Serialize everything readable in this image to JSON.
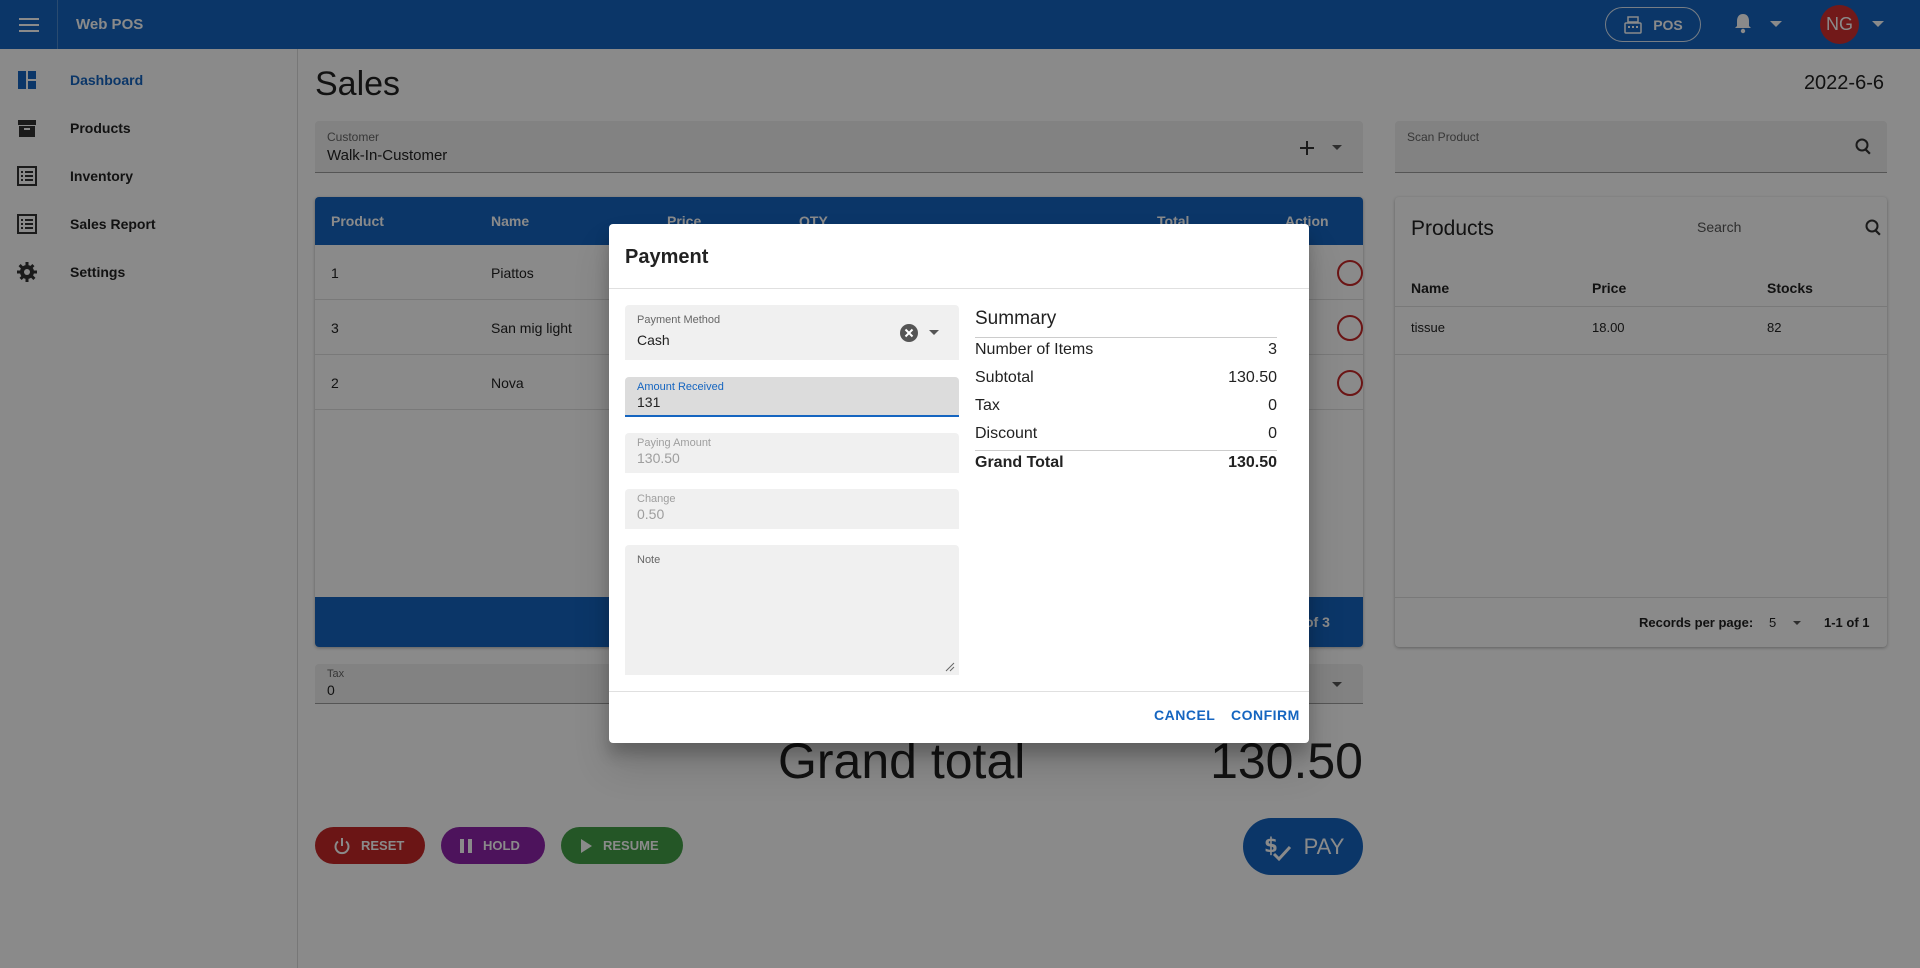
{
  "app": {
    "title": "Web POS",
    "pos_label": "POS",
    "avatar_initials": "NG"
  },
  "sidebar": {
    "items": [
      {
        "label": "Dashboard",
        "icon": "dashboard-icon"
      },
      {
        "label": "Products",
        "icon": "archive-icon"
      },
      {
        "label": "Inventory",
        "icon": "list-icon"
      },
      {
        "label": "Sales Report",
        "icon": "list-icon"
      },
      {
        "label": "Settings",
        "icon": "gear-icon"
      }
    ]
  },
  "page": {
    "title": "Sales",
    "date": "2022-6-6"
  },
  "customer": {
    "label": "Customer",
    "value": "Walk-In-Customer"
  },
  "scan": {
    "label": "Scan Product"
  },
  "sales_table": {
    "columns": [
      "Product",
      "Name",
      "Price",
      "QTY",
      "Total",
      "Action"
    ],
    "rows": [
      {
        "product": "1",
        "name": "Piattos"
      },
      {
        "product": "3",
        "name": "San mig light"
      },
      {
        "product": "2",
        "name": "Nova"
      }
    ],
    "footer": "of 3"
  },
  "tax_field": {
    "label": "Tax",
    "value": "0"
  },
  "grand_total": {
    "label": "Grand total",
    "value": "130.50"
  },
  "actions": {
    "reset": "RESET",
    "hold": "HOLD",
    "resume": "RESUME",
    "pay": "PAY"
  },
  "products_panel": {
    "title": "Products",
    "search_placeholder": "Search",
    "columns": [
      "Name",
      "Price",
      "Stocks"
    ],
    "rows": [
      {
        "name": "tissue",
        "price": "18.00",
        "stocks": "82"
      }
    ],
    "records_label": "Records per page:",
    "records_value": "5",
    "range": "1-1 of 1"
  },
  "payment_dialog": {
    "title": "Payment",
    "payment_method": {
      "label": "Payment Method",
      "value": "Cash"
    },
    "amount_received": {
      "label": "Amount Received",
      "value": "131"
    },
    "paying_amount": {
      "label": "Paying Amount",
      "value": "130.50"
    },
    "change": {
      "label": "Change",
      "value": "0.50"
    },
    "note": {
      "label": "Note",
      "value": ""
    },
    "summary": {
      "title": "Summary",
      "rows": [
        {
          "label": "Number of Items",
          "value": "3"
        },
        {
          "label": "Subtotal",
          "value": "130.50"
        },
        {
          "label": "Tax",
          "value": "0"
        },
        {
          "label": "Discount",
          "value": "0"
        },
        {
          "label": "Grand Total",
          "value": "130.50"
        }
      ]
    },
    "cancel_label": "CANCEL",
    "confirm_label": "CONFIRM"
  },
  "colors": {
    "primary": "#1565c0",
    "reset": "#c62828",
    "hold": "#8e24aa",
    "resume": "#43a047",
    "avatar": "#d32f2f"
  }
}
